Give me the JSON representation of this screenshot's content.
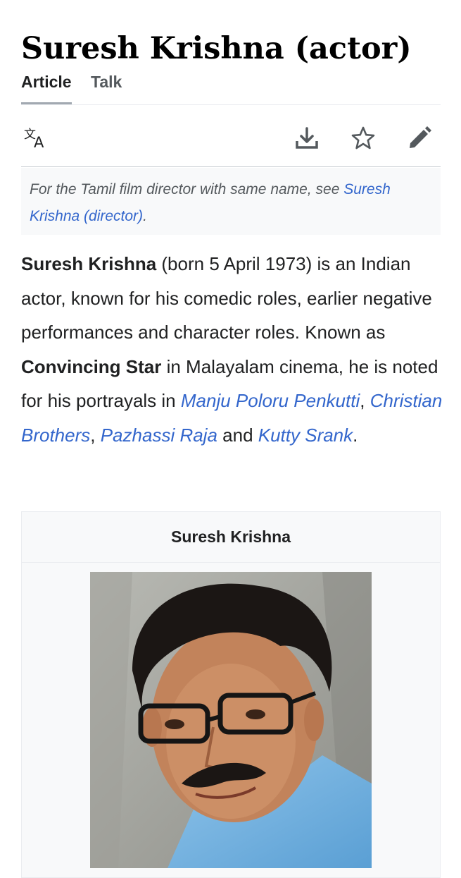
{
  "article": {
    "title": "Suresh Krishna (actor)",
    "tabs": [
      {
        "label": "Article"
      },
      {
        "label": "Talk"
      }
    ],
    "toolbar": {
      "icons": [
        "language-icon",
        "download-icon",
        "star-icon",
        "edit-icon"
      ]
    },
    "hatnote": {
      "prefix": "For the Tamil film director with same name, see ",
      "link": "Suresh Krishna (director)",
      "suffix": "."
    },
    "lead": {
      "name": "Suresh Krishna",
      "t1": " (born 5 April 1973) is an Indian actor, known for his comedic roles, earlier negative performances and character roles. Known as ",
      "nickname": "Convincing Star",
      "t2": " in Malayalam cinema, he is noted for his portrayals in ",
      "film1": "Manju Poloru Penkutti",
      "sep1": ", ",
      "film2": "Christian Brothers",
      "sep2": ", ",
      "film3": "Pazhassi Raja",
      "sep3": " and ",
      "film4": "Kutty Srank",
      "end": "."
    },
    "infobox": {
      "title": "Suresh Krishna"
    }
  },
  "colors": {
    "link": "#3366cc",
    "text": "#202122",
    "muted": "#54595d",
    "hatnote_bg": "#f8f9fa"
  }
}
